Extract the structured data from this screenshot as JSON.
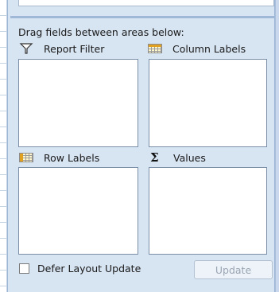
{
  "panel": {
    "instruction": "Drag fields between areas below:"
  },
  "areas": {
    "report_filter": {
      "label": "Report Filter",
      "icon": "filter-icon"
    },
    "column_labels": {
      "label": "Column Labels",
      "icon": "column-labels-icon"
    },
    "row_labels": {
      "label": "Row Labels",
      "icon": "row-labels-icon"
    },
    "values": {
      "label": "Values",
      "icon": "sigma-icon"
    }
  },
  "footer": {
    "defer_label": "Defer Layout Update",
    "defer_checked": false,
    "update_label": "Update",
    "update_enabled": false
  },
  "colors": {
    "panel_bg": "#d7e4f2",
    "area_border": "#7a8ea8",
    "disabled_text": "#9aa5b3"
  }
}
